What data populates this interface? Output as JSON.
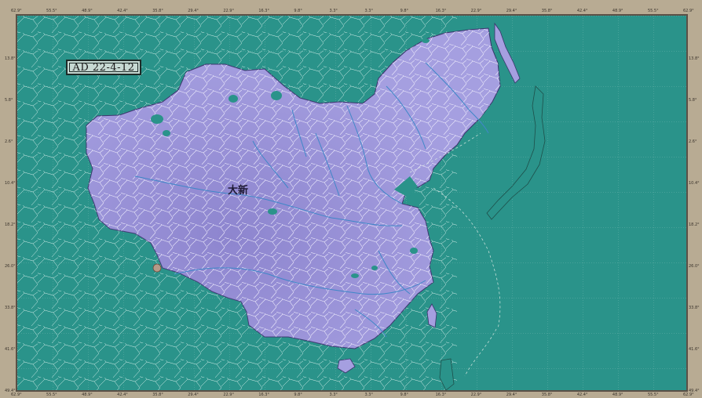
{
  "date_label": "AD 22-4-12",
  "country_label": "大新",
  "colors": {
    "sea": "#2a938a",
    "territory": "#a59fe0",
    "territory_dark": "#7d73c2",
    "borders": "#e8e8f4",
    "frame": "#b8ab93",
    "river": "#3f87c8"
  },
  "top_ticks": [
    "62.9°",
    "55.5°",
    "48.9°",
    "42.4°",
    "35.8°",
    "29.4°",
    "22.9°",
    "16.3°",
    "9.8°",
    "3.3°",
    "3.3°",
    "9.8°",
    "16.3°",
    "22.9°",
    "29.4°",
    "35.8°",
    "42.4°",
    "48.9°",
    "55.5°",
    "62.9°"
  ],
  "bottom_ticks": [
    "62.9°",
    "55.5°",
    "48.9°",
    "42.4°",
    "35.8°",
    "29.4°",
    "22.9°",
    "16.3°",
    "9.8°",
    "3.3°",
    "3.3°",
    "9.8°",
    "16.3°",
    "22.9°",
    "29.4°",
    "35.8°",
    "42.4°",
    "48.9°",
    "55.5°",
    "62.9°"
  ],
  "left_ticks": [
    "13.8°",
    "5.8°",
    "2.6°",
    "10.4°",
    "18.2°",
    "26.0°",
    "33.8°",
    "41.6°",
    "49.4°"
  ],
  "right_ticks": [
    "13.8°",
    "5.8°",
    "2.6°",
    "10.4°",
    "18.2°",
    "26.0°",
    "33.8°",
    "41.6°",
    "49.4°"
  ]
}
